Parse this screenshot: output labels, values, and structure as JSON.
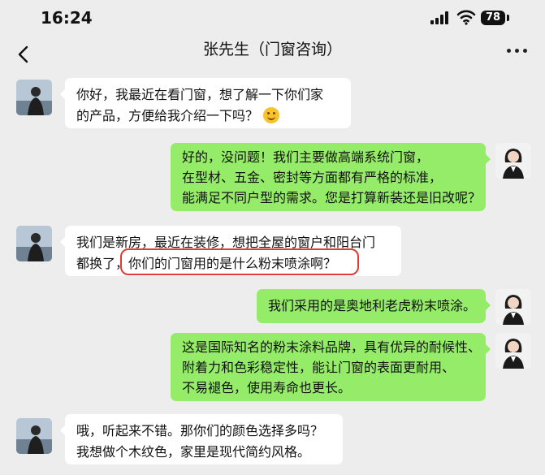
{
  "status": {
    "time": "16:24",
    "battery": "78"
  },
  "nav": {
    "title": "张先生（门窗咨询）"
  },
  "messages": [
    {
      "side": "left",
      "lines": [
        "你好，我最近在看门窗，想了解一下你们家",
        "的产品，方便给我介绍一下吗？"
      ],
      "emoji": "smile-emoji"
    },
    {
      "side": "right",
      "lines": [
        "好的，没问题！我们主要做高端系统门窗，",
        "在型材、五金、密封等方面都有严格的标准，",
        "能满足不同户型的需求。您是打算新装还是旧改呢？"
      ]
    },
    {
      "side": "left",
      "lines": [
        "我们是新房，最近在装修，想把全屋的窗户和阳台门",
        "都换了，你们的门窗用的是什么粉末喷涂啊？"
      ]
    },
    {
      "side": "right",
      "lines": [
        "我们采用的是奥地利老虎粉末喷涂。"
      ]
    },
    {
      "side": "right",
      "lines": [
        "这是国际知名的粉末涂料品牌，具有优异的耐候性、",
        "附着力和色彩稳定性，能让门窗的表面更耐用、",
        "不易褪色，使用寿命也更长。"
      ]
    },
    {
      "side": "left",
      "lines": [
        "哦，听起来不错。那你们的颜色选择多吗？",
        "我想做个木纹色，家里是现代简约风格。"
      ]
    }
  ],
  "colors": {
    "highlight": "#e03a34",
    "bubble_right": "#95ec69",
    "bubble_left": "#ffffff",
    "background": "#ededed"
  }
}
